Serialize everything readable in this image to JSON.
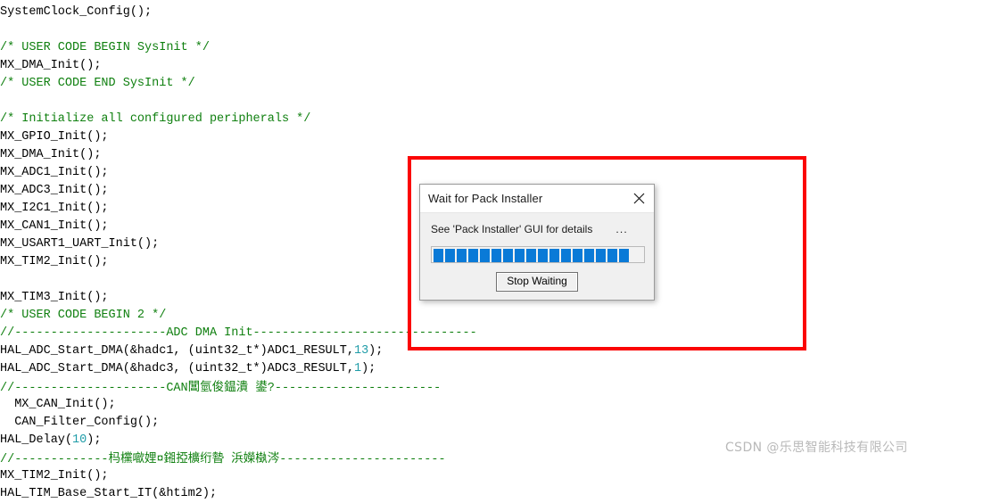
{
  "editor": {
    "lines": [
      {
        "text": "SystemClock_Config();",
        "type": "plain"
      },
      {
        "text": "",
        "type": "plain"
      },
      {
        "text": "/* USER CODE BEGIN SysInit */",
        "type": "comment"
      },
      {
        "text": "MX_DMA_Init();",
        "type": "plain"
      },
      {
        "text": "/* USER CODE END SysInit */",
        "type": "comment"
      },
      {
        "text": "",
        "type": "plain"
      },
      {
        "text": "/* Initialize all configured peripherals */",
        "type": "comment"
      },
      {
        "text": "MX_GPIO_Init();",
        "type": "plain"
      },
      {
        "text": "MX_DMA_Init();",
        "type": "plain"
      },
      {
        "text": "MX_ADC1_Init();",
        "type": "plain"
      },
      {
        "text": "MX_ADC3_Init();",
        "type": "plain"
      },
      {
        "text": "MX_I2C1_Init();",
        "type": "plain"
      },
      {
        "text": "MX_CAN1_Init();",
        "type": "plain"
      },
      {
        "text": "MX_USART1_UART_Init();",
        "type": "plain"
      },
      {
        "text": "MX_TIM2_Init();",
        "type": "plain"
      },
      {
        "text": "",
        "type": "plain"
      },
      {
        "text": "MX_TIM3_Init();",
        "type": "plain"
      },
      {
        "text": "/* USER CODE BEGIN 2 */",
        "type": "comment"
      },
      {
        "text": "//---------------------ADC DMA Init-------------------------------",
        "type": "comment"
      },
      {
        "text": "HAL_ADC_Start_DMA(&hadc1, (uint32_t*)ADC1_RESULT,13);",
        "type": "call",
        "number": "13"
      },
      {
        "text": "HAL_ADC_Start_DMA(&hadc3, (uint32_t*)ADC3_RESULT,1);",
        "type": "call",
        "number": "1"
      },
      {
        "text": "//---------------------CAN閶氫俊鎾潰 鍙?-----------------------",
        "type": "comment"
      },
      {
        "text": "  MX_CAN_Init();",
        "type": "plain"
      },
      {
        "text": "  CAN_Filter_Config();",
        "type": "plain"
      },
      {
        "text": "HAL_Delay(10);",
        "type": "call",
        "number": "10"
      },
      {
        "text": "//-------------杩欓噷娌¤鎺掗櫎绗暬 浜嬫槸涔-----------------------",
        "type": "comment"
      },
      {
        "text": "MX_TIM2_Init();",
        "type": "plain"
      },
      {
        "text": "HAL_TIM_Base_Start_IT(&htim2);",
        "type": "plain"
      }
    ]
  },
  "dialog": {
    "title": "Wait for Pack Installer",
    "close_label": "Close",
    "message": "See 'Pack Installer' GUI for details",
    "ellipsis": "...",
    "progress": {
      "segments": 17,
      "total_segments": 20,
      "fill_color": "#0a7ad7",
      "track_color": "#f2f2f2"
    },
    "stop_button_label": "Stop Waiting"
  },
  "annotation": {
    "color": "#fb0505"
  },
  "watermark": {
    "text": "CSDN @乐思智能科技有限公司"
  }
}
